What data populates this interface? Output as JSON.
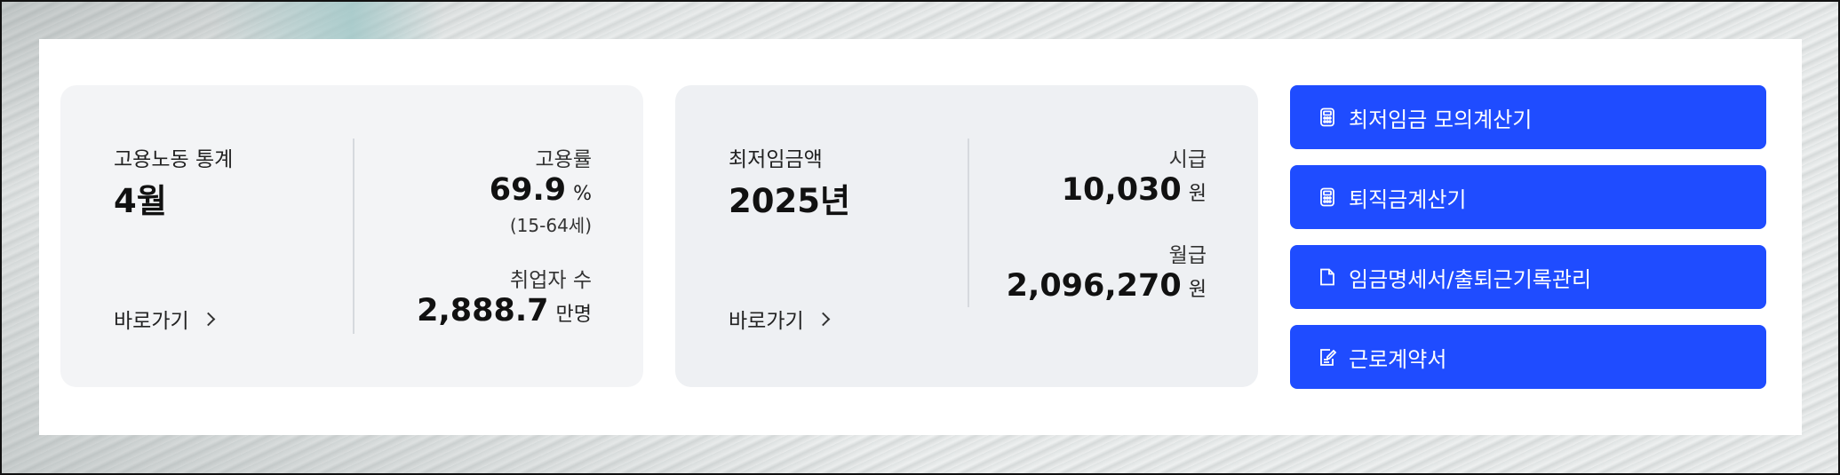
{
  "employment": {
    "title": "고용노동 통계",
    "month": "4월",
    "rate_label": "고용률",
    "rate_value": "69.9",
    "rate_unit": "%",
    "rate_note": "(15-64세)",
    "employed_label": "취업자 수",
    "employed_value": "2,888.7",
    "employed_unit": "만명",
    "go_label": "바로가기"
  },
  "min_wage": {
    "title": "최저임금액",
    "year": "2025년",
    "hourly_label": "시급",
    "hourly_value": "10,030",
    "hourly_unit": "원",
    "monthly_label": "월급",
    "monthly_value": "2,096,270",
    "monthly_unit": "원",
    "go_label": "바로가기"
  },
  "buttons": [
    {
      "label": "최저임금 모의계산기",
      "icon": "calculator-icon"
    },
    {
      "label": "퇴직금계산기",
      "icon": "calculator-icon"
    },
    {
      "label": "임금명세서/출퇴근기록관리",
      "icon": "document-icon"
    },
    {
      "label": "근로계약서",
      "icon": "contract-edit-icon"
    }
  ],
  "colors": {
    "button_bg": "#1f4cff",
    "card_bg": "#f3f4f6"
  }
}
